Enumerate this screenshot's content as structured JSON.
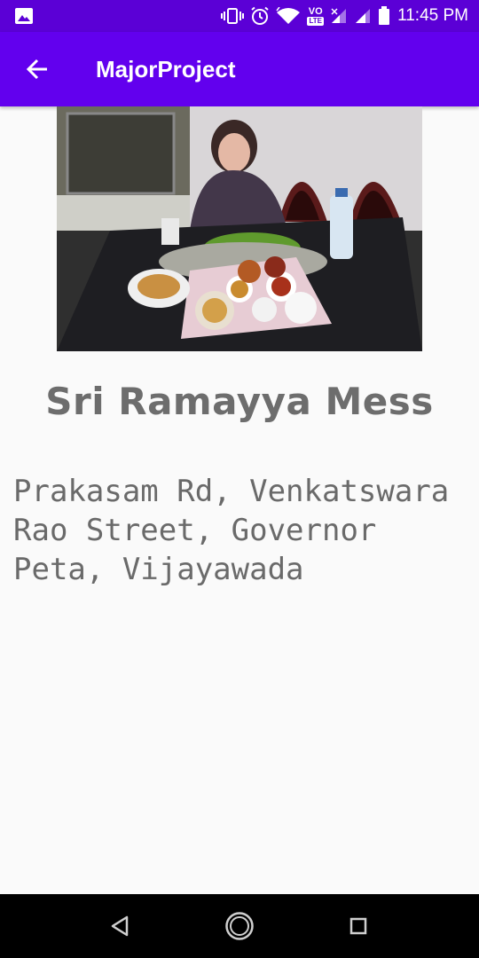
{
  "status_bar": {
    "time": "11:45 PM",
    "left_icon": "image-icon",
    "icons": [
      "vibrate-icon",
      "alarm-icon",
      "wifi-icon",
      "volte-icon",
      "signal-icon",
      "signal-icon",
      "battery-icon"
    ],
    "volte_label": "VO",
    "lte_label": "LTE"
  },
  "app_bar": {
    "title": "MajorProject",
    "back_icon": "arrow-left-icon",
    "color": "#6200ee"
  },
  "restaurant": {
    "photo_icon": "restaurant-photo",
    "name": "Sri Ramayya Mess",
    "address": "Prakasam Rd, Venkatswara Rao Street, Governor Peta, Vijayawada"
  },
  "nav_bar": {
    "back": "nav-back-icon",
    "home": "nav-home-icon",
    "recents": "nav-recents-icon"
  }
}
